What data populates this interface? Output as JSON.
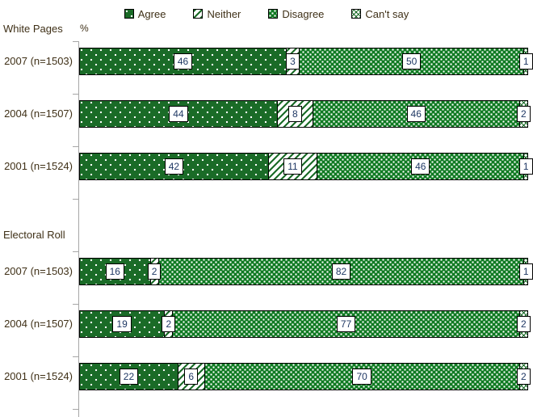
{
  "legend": {
    "items": [
      {
        "label": "Agree",
        "icon": "legend-swatch-agree",
        "pattern": "dotted-sparse-green",
        "color": "#1a6b27"
      },
      {
        "label": "Neither",
        "icon": "legend-swatch-neither",
        "pattern": "diagonal-stripes",
        "color": "#1a6b27"
      },
      {
        "label": "Disagree",
        "icon": "legend-swatch-disagree",
        "pattern": "dotted-dense-green",
        "color": "#0f7a22"
      },
      {
        "label": "Can't say",
        "icon": "legend-swatch-cantsay",
        "pattern": "cross-hatch",
        "color": "#1a6b27"
      }
    ]
  },
  "axis": {
    "unit_label": "%"
  },
  "groups": [
    {
      "name": "White Pages"
    },
    {
      "name": "Electoral Roll"
    }
  ],
  "chart_data": {
    "type": "bar",
    "orientation": "horizontal",
    "stacked": true,
    "normalized_percent": true,
    "title": "",
    "xlabel": "%",
    "ylabel": "",
    "xlim": [
      0,
      100
    ],
    "grid": false,
    "legend_position": "top-center",
    "group_labels": [
      "White Pages",
      "Electoral Roll"
    ],
    "categories": [
      "2007 (n=1503)",
      "2004 (n=1507)",
      "2001 (n=1524)",
      "2007 (n=1503)",
      "2004 (n=1507)",
      "2001 (n=1524)"
    ],
    "series": [
      {
        "name": "Agree",
        "values": [
          46,
          44,
          42,
          16,
          19,
          22
        ]
      },
      {
        "name": "Neither",
        "values": [
          3,
          8,
          11,
          2,
          2,
          6
        ]
      },
      {
        "name": "Disagree",
        "values": [
          50,
          46,
          46,
          82,
          77,
          70
        ]
      },
      {
        "name": "Can't say",
        "values": [
          1,
          2,
          1,
          1,
          2,
          2
        ]
      }
    ],
    "bars": [
      {
        "group": "White Pages",
        "category": "2007 (n=1503)",
        "segments": [
          {
            "series": "Agree",
            "value": 46,
            "label": "46"
          },
          {
            "series": "Neither",
            "value": 3,
            "label": "3"
          },
          {
            "series": "Disagree",
            "value": 50,
            "label": "50"
          },
          {
            "series": "Can't say",
            "value": 1,
            "label": "1"
          }
        ]
      },
      {
        "group": "White Pages",
        "category": "2004 (n=1507)",
        "segments": [
          {
            "series": "Agree",
            "value": 44,
            "label": "44"
          },
          {
            "series": "Neither",
            "value": 8,
            "label": "8"
          },
          {
            "series": "Disagree",
            "value": 46,
            "label": "46"
          },
          {
            "series": "Can't say",
            "value": 2,
            "label": "2"
          }
        ]
      },
      {
        "group": "White Pages",
        "category": "2001 (n=1524)",
        "segments": [
          {
            "series": "Agree",
            "value": 42,
            "label": "42"
          },
          {
            "series": "Neither",
            "value": 11,
            "label": "11"
          },
          {
            "series": "Disagree",
            "value": 46,
            "label": "46"
          },
          {
            "series": "Can't say",
            "value": 1,
            "label": "1"
          }
        ]
      },
      {
        "group": "Electoral Roll",
        "category": "2007 (n=1503)",
        "segments": [
          {
            "series": "Agree",
            "value": 16,
            "label": "16"
          },
          {
            "series": "Neither",
            "value": 2,
            "label": "2"
          },
          {
            "series": "Disagree",
            "value": 82,
            "label": "82"
          },
          {
            "series": "Can't say",
            "value": 1,
            "label": "1"
          }
        ]
      },
      {
        "group": "Electoral Roll",
        "category": "2004 (n=1507)",
        "segments": [
          {
            "series": "Agree",
            "value": 19,
            "label": "19"
          },
          {
            "series": "Neither",
            "value": 2,
            "label": "2"
          },
          {
            "series": "Disagree",
            "value": 77,
            "label": "77"
          },
          {
            "series": "Can't say",
            "value": 2,
            "label": "2"
          }
        ]
      },
      {
        "group": "Electoral Roll",
        "category": "2001 (n=1524)",
        "segments": [
          {
            "series": "Agree",
            "value": 22,
            "label": "22"
          },
          {
            "series": "Neither",
            "value": 6,
            "label": "6"
          },
          {
            "series": "Disagree",
            "value": 70,
            "label": "70"
          },
          {
            "series": "Can't say",
            "value": 2,
            "label": "2"
          }
        ]
      }
    ]
  }
}
